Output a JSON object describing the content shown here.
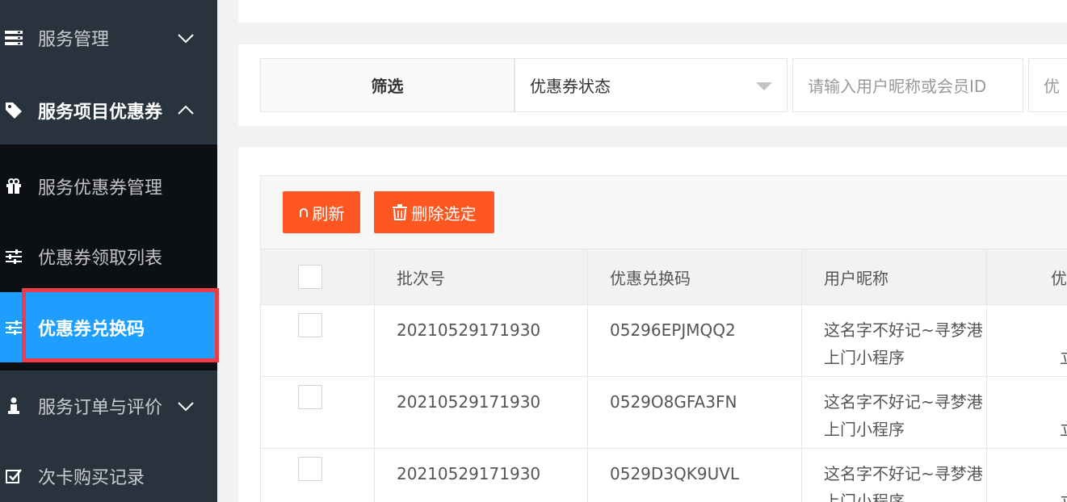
{
  "sidebar": {
    "items": [
      {
        "label": "服务管理",
        "icon": "server-icon"
      },
      {
        "label": "服务项目优惠券",
        "icon": "tag-icon"
      },
      {
        "label": "服务优惠券管理",
        "icon": "gift-icon"
      },
      {
        "label": "优惠券领取列表",
        "icon": "sliders-icon"
      },
      {
        "label": "优惠券兑换码",
        "icon": "sliders-icon"
      },
      {
        "label": "服务订单与评价",
        "icon": "person-icon"
      },
      {
        "label": "次卡购买记录",
        "icon": "checkbox-icon"
      }
    ]
  },
  "filter": {
    "label": "筛选",
    "status_select": "优惠券状态",
    "user_placeholder": "请输入用户昵称或会员ID",
    "code_placeholder": "优"
  },
  "toolbar": {
    "refresh_label": "刷新",
    "delete_label": "删除选定"
  },
  "table": {
    "headers": [
      "批次号",
      "优惠兑换码",
      "用户昵称",
      "优"
    ],
    "rows": [
      {
        "batch": "20210529171930",
        "code": "05296EPJMQQ2",
        "user": "这名字不好记~寻梦港上门小程序",
        "extra": "立"
      },
      {
        "batch": "20210529171930",
        "code": "0529O8GFA3FN",
        "user": "这名字不好记~寻梦港上门小程序",
        "extra": "立"
      },
      {
        "batch": "20210529171930",
        "code": "0529D3QK9UVL",
        "user": "这名字不好记~寻梦港上门小程序",
        "extra": "立"
      }
    ]
  },
  "colors": {
    "sidebar_bg": "#28333e",
    "active_bg": "#1e9fff",
    "button_bg": "#ff5722",
    "highlight": "#ef3a4a"
  }
}
